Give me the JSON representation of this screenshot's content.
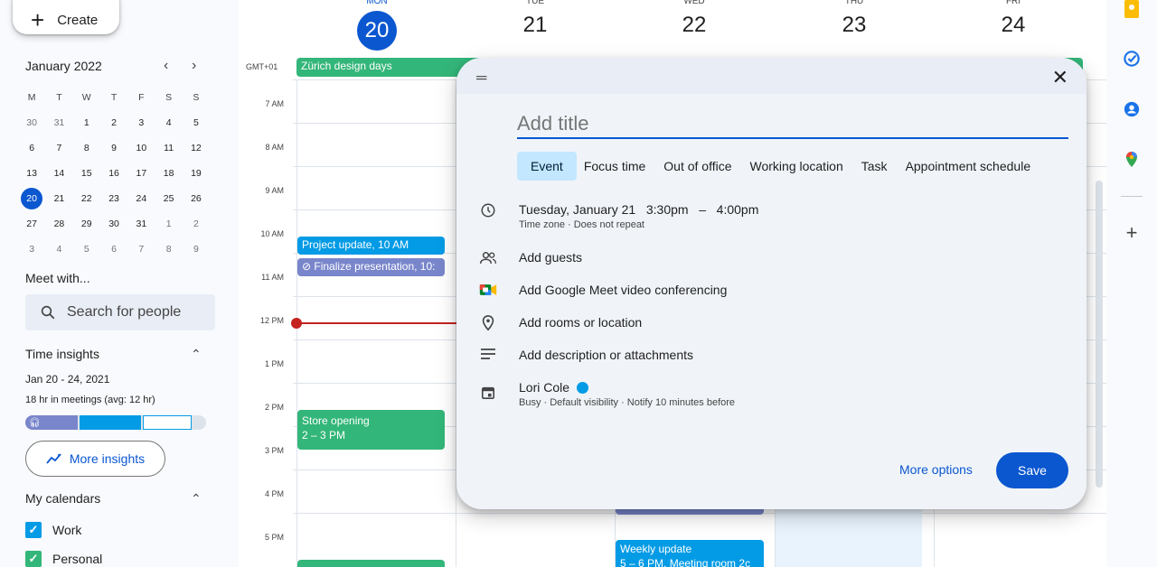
{
  "sidebar": {
    "create_label": "Create",
    "mini_calendar": {
      "month_label": "January 2022",
      "weekday_headers": [
        "M",
        "T",
        "W",
        "T",
        "F",
        "S",
        "S"
      ],
      "days": [
        [
          "30",
          "31",
          "1",
          "2",
          "3",
          "4",
          "5"
        ],
        [
          "6",
          "7",
          "8",
          "9",
          "10",
          "11",
          "12"
        ],
        [
          "13",
          "14",
          "15",
          "16",
          "17",
          "18",
          "19"
        ],
        [
          "20",
          "21",
          "22",
          "23",
          "24",
          "25",
          "26"
        ],
        [
          "27",
          "28",
          "29",
          "30",
          "31",
          "1",
          "2"
        ],
        [
          "3",
          "4",
          "5",
          "6",
          "7",
          "8",
          "9"
        ]
      ],
      "today": "20"
    },
    "meet_with_title": "Meet with...",
    "search_placeholder": "Search for people",
    "time_insights": {
      "title": "Time insights",
      "range": "Jan 20 - 24, 2021",
      "meetings": "18 hr in meetings (avg: 12 hr)",
      "more_insights": "More insights"
    },
    "my_calendars": {
      "title": "My calendars",
      "items": [
        {
          "label": "Work",
          "color": "#039be5"
        },
        {
          "label": "Personal",
          "color": "#33b679"
        }
      ]
    }
  },
  "week_header": {
    "days": [
      {
        "name": "MON",
        "num": "20",
        "today": true
      },
      {
        "name": "TUE",
        "num": "21"
      },
      {
        "name": "WED",
        "num": "22"
      },
      {
        "name": "THU",
        "num": "23"
      },
      {
        "name": "FRI",
        "num": "24"
      }
    ],
    "timezone": "GMT+01"
  },
  "hours": [
    "7 AM",
    "8 AM",
    "9 AM",
    "10 AM",
    "11 AM",
    "12 PM",
    "1 PM",
    "2 PM",
    "3 PM",
    "4 PM",
    "5 PM"
  ],
  "events": {
    "all_day": "Zürich design days",
    "project_update": "Project update, 10 AM",
    "finalize": "⊘ Finalize presentation, 10:",
    "store_opening_title": "Store opening",
    "store_opening_time": "2 – 3 PM",
    "weekly_update_title": "Weekly update",
    "weekly_update_time": "5 – 6 PM, Meeting room 2c"
  },
  "dialog": {
    "title_placeholder": "Add title",
    "tabs": [
      "Event",
      "Focus time",
      "Out of office",
      "Working location",
      "Task",
      "Appointment schedule"
    ],
    "date_time": "Tuesday, January 21   3:30pm   –   4:00pm",
    "time_sub": "Time zone · Does not repeat",
    "add_guests": "Add guests",
    "add_meet": "Add Google Meet video conferencing",
    "add_location": "Add rooms or location",
    "add_description": "Add description or attachments",
    "owner": "Lori Cole",
    "owner_sub": "Busy · Default visibility · Notify 10 minutes before",
    "more_options": "More options",
    "save": "Save"
  },
  "colors": {
    "accent": "#0b57d0",
    "event_green": "#33b679",
    "event_blue": "#039be5",
    "event_lavender": "#7986cb",
    "now_line": "#c5221f"
  }
}
